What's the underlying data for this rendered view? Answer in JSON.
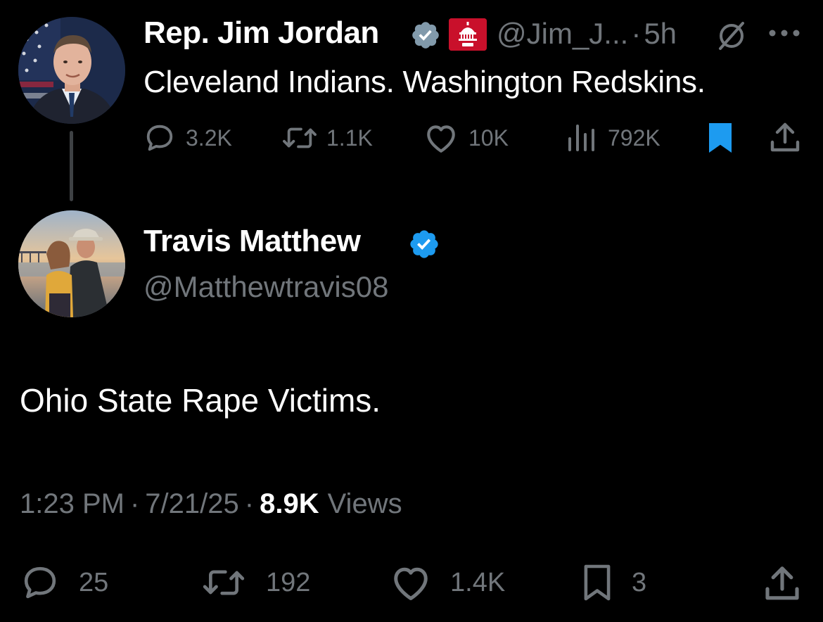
{
  "parent_tweet": {
    "author_name": "Rep. Jim Jordan",
    "handle": "@Jim_J...",
    "time": "5h",
    "separator": "·",
    "text": "Cleveland Indians. Washington Redskins.",
    "affiliation_icon": "house-gop-capitol-badge",
    "actions": {
      "replies": "3.2K",
      "reposts": "1.1K",
      "likes": "10K",
      "views": "792K"
    }
  },
  "reply_tweet": {
    "author_name": "Travis Matthew",
    "handle": "@Matthewtravis08",
    "text": "Ohio State Rape Victims.",
    "time": "1:23 PM",
    "date": "7/21/25",
    "separator": "·",
    "views_count": "8.9K",
    "views_label": "Views",
    "actions": {
      "replies": "25",
      "reposts": "192",
      "likes": "1.4K",
      "bookmarks": "3"
    }
  },
  "colors": {
    "background": "#000000",
    "text_primary": "#ffffff",
    "text_secondary": "#71767b",
    "verified_blue": "#1d9bf0",
    "verified_gray": "#829aab",
    "bookmark_active": "#1d9bf0",
    "affiliation_red": "#c9102b"
  }
}
